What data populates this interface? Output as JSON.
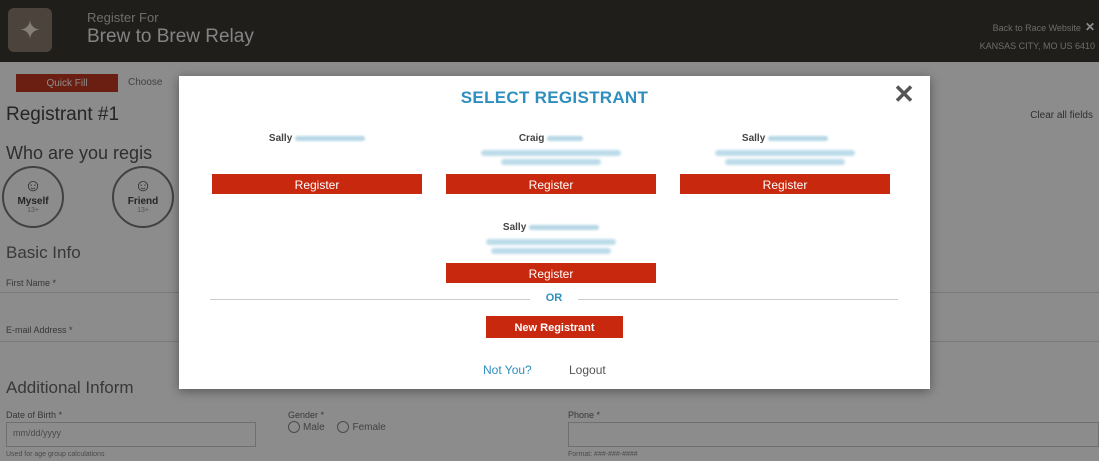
{
  "header": {
    "pre_title": "Register For",
    "event_name": "Brew to Brew Relay",
    "back_link": "Back to Race Website",
    "location": "KANSAS CITY, MO US 6410",
    "close_glyph": "✕"
  },
  "page": {
    "quick_fill": "Quick Fill",
    "choose_text": "Choose",
    "registrant_title": "Registrant #1",
    "clear_all": "Clear all fields",
    "who_question": "Who are you regis",
    "options": [
      {
        "label": "Myself",
        "sub": "13+"
      },
      {
        "label": "Friend",
        "sub": "13+"
      }
    ],
    "basic_info": "Basic Info",
    "first_name_label": "First Name *",
    "email_label": "E-mail Address *",
    "additional_info": "Additional Inform",
    "dob_label": "Date of Birth *",
    "dob_placeholder": "mm/dd/yyyy",
    "dob_hint": "Used for age group calculations",
    "gender_label": "Gender *",
    "gender_male": "Male",
    "gender_female": "Female",
    "phone_label": "Phone *",
    "phone_hint": "Format: ###-###-####"
  },
  "modal": {
    "title": "SELECT REGISTRANT",
    "close_glyph": "✕",
    "registrants": [
      {
        "name": "Sally",
        "button": "Register"
      },
      {
        "name": "Craig",
        "button": "Register"
      },
      {
        "name": "Sally",
        "button": "Register"
      },
      {
        "name": "Sally",
        "button": "Register"
      }
    ],
    "or_text": "OR",
    "new_registrant": "New Registrant",
    "not_you": "Not You?",
    "logout": "Logout"
  },
  "colors": {
    "accent_blue": "#2e8fbe",
    "button_red": "#c8280e",
    "header_dark": "#3b3732"
  }
}
